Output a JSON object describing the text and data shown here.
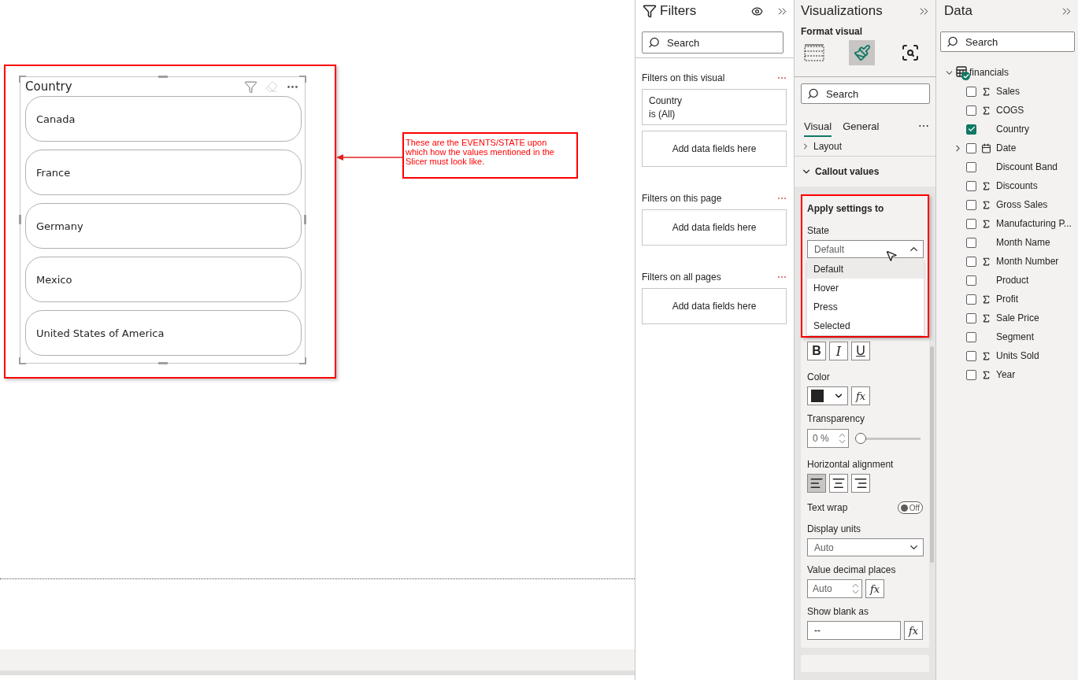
{
  "canvas": {
    "slicer": {
      "title": "Country",
      "items": [
        {
          "label": "Canada"
        },
        {
          "label": "France"
        },
        {
          "label": "Germany"
        },
        {
          "label": "Mexico"
        },
        {
          "label": "United States of America"
        }
      ]
    },
    "callout": {
      "text": "These are the EVENTS/STATE upon which how the values mentioned in the Slicer must look like."
    }
  },
  "filters": {
    "title": "Filters",
    "search": {
      "placeholder": "Search"
    },
    "sections": [
      {
        "title": "Filters on this visual",
        "more": "⋯",
        "cards": [
          {
            "kind": "filter",
            "field": "Country",
            "condition": "is (All)"
          },
          {
            "kind": "drop",
            "label": "Add data fields here"
          }
        ]
      },
      {
        "title": "Filters on this page",
        "more": "⋯",
        "cards": [
          {
            "kind": "drop",
            "label": "Add data fields here"
          }
        ]
      },
      {
        "title": "Filters on all pages",
        "more": "⋯",
        "cards": [
          {
            "kind": "drop",
            "label": "Add data fields here"
          }
        ]
      }
    ]
  },
  "visualizations": {
    "title": "Visualizations",
    "subtitle": "Format visual",
    "format_tabs": [
      {
        "kind": "build",
        "selected": false
      },
      {
        "kind": "format",
        "selected": true
      },
      {
        "kind": "analytics",
        "selected": false
      }
    ],
    "search": {
      "placeholder": "Search"
    },
    "tabs": [
      {
        "label": "Visual",
        "selected": true
      },
      {
        "label": "General",
        "selected": false
      }
    ],
    "more": "⋯",
    "sections": [
      {
        "label": "Layout",
        "expanded": false
      },
      {
        "label": "Callout values",
        "expanded": true
      }
    ],
    "apply_settings": {
      "title": "Apply settings to",
      "state_label": "State",
      "state_value": "Default",
      "expanded": true,
      "options": [
        {
          "label": "Default",
          "selected": true
        },
        {
          "label": "Hover",
          "selected": false
        },
        {
          "label": "Press",
          "selected": false
        },
        {
          "label": "Selected",
          "selected": false
        }
      ]
    },
    "font_style": [
      {
        "label": "B",
        "kind": "bold"
      },
      {
        "label": "I",
        "kind": "italic"
      },
      {
        "label": "U",
        "kind": "underline"
      }
    ],
    "color": {
      "label": "Color",
      "color": "#252423",
      "fx": "fx"
    },
    "transparency": {
      "label": "Transparency",
      "value": "0 %",
      "level": 0
    },
    "alignment": {
      "label": "Horizontal alignment",
      "options": [
        {
          "kind": "left",
          "selected": true
        },
        {
          "kind": "center",
          "selected": false
        },
        {
          "kind": "right",
          "selected": false
        }
      ]
    },
    "text_wrap": {
      "label": "Text wrap",
      "on": false,
      "state_label": "Off"
    },
    "display_units": {
      "label": "Display units",
      "value": "Auto"
    },
    "decimal_places": {
      "label": "Value decimal places",
      "value": "Auto",
      "fx": "fx"
    },
    "blank": {
      "label": "Show blank as",
      "value": "--",
      "fx": "fx"
    }
  },
  "data": {
    "title": "Data",
    "search": {
      "placeholder": "Search"
    },
    "table": {
      "name": "financials",
      "expanded": true,
      "fields": [
        {
          "label": "Sales",
          "kind": "sum",
          "checked": false,
          "expandable": false
        },
        {
          "label": "COGS",
          "kind": "sum",
          "checked": false,
          "expandable": false
        },
        {
          "label": "Country",
          "kind": "text",
          "checked": true,
          "expandable": false
        },
        {
          "label": "Date",
          "kind": "calendar",
          "checked": false,
          "expandable": true
        },
        {
          "label": "Discount Band",
          "kind": "text",
          "checked": false,
          "expandable": false
        },
        {
          "label": "Discounts",
          "kind": "sum",
          "checked": false,
          "expandable": false
        },
        {
          "label": "Gross Sales",
          "kind": "sum",
          "checked": false,
          "expandable": false
        },
        {
          "label": "Manufacturing P...",
          "kind": "sum",
          "checked": false,
          "expandable": false
        },
        {
          "label": "Month Name",
          "kind": "text",
          "checked": false,
          "expandable": false
        },
        {
          "label": "Month Number",
          "kind": "sum",
          "checked": false,
          "expandable": false
        },
        {
          "label": "Product",
          "kind": "text",
          "checked": false,
          "expandable": false
        },
        {
          "label": "Profit",
          "kind": "sum",
          "checked": false,
          "expandable": false
        },
        {
          "label": "Sale Price",
          "kind": "sum",
          "checked": false,
          "expandable": false
        },
        {
          "label": "Segment",
          "kind": "text",
          "checked": false,
          "expandable": false
        },
        {
          "label": "Units Sold",
          "kind": "sum",
          "checked": false,
          "expandable": false
        },
        {
          "label": "Year",
          "kind": "sum",
          "checked": false,
          "expandable": false
        }
      ]
    }
  }
}
